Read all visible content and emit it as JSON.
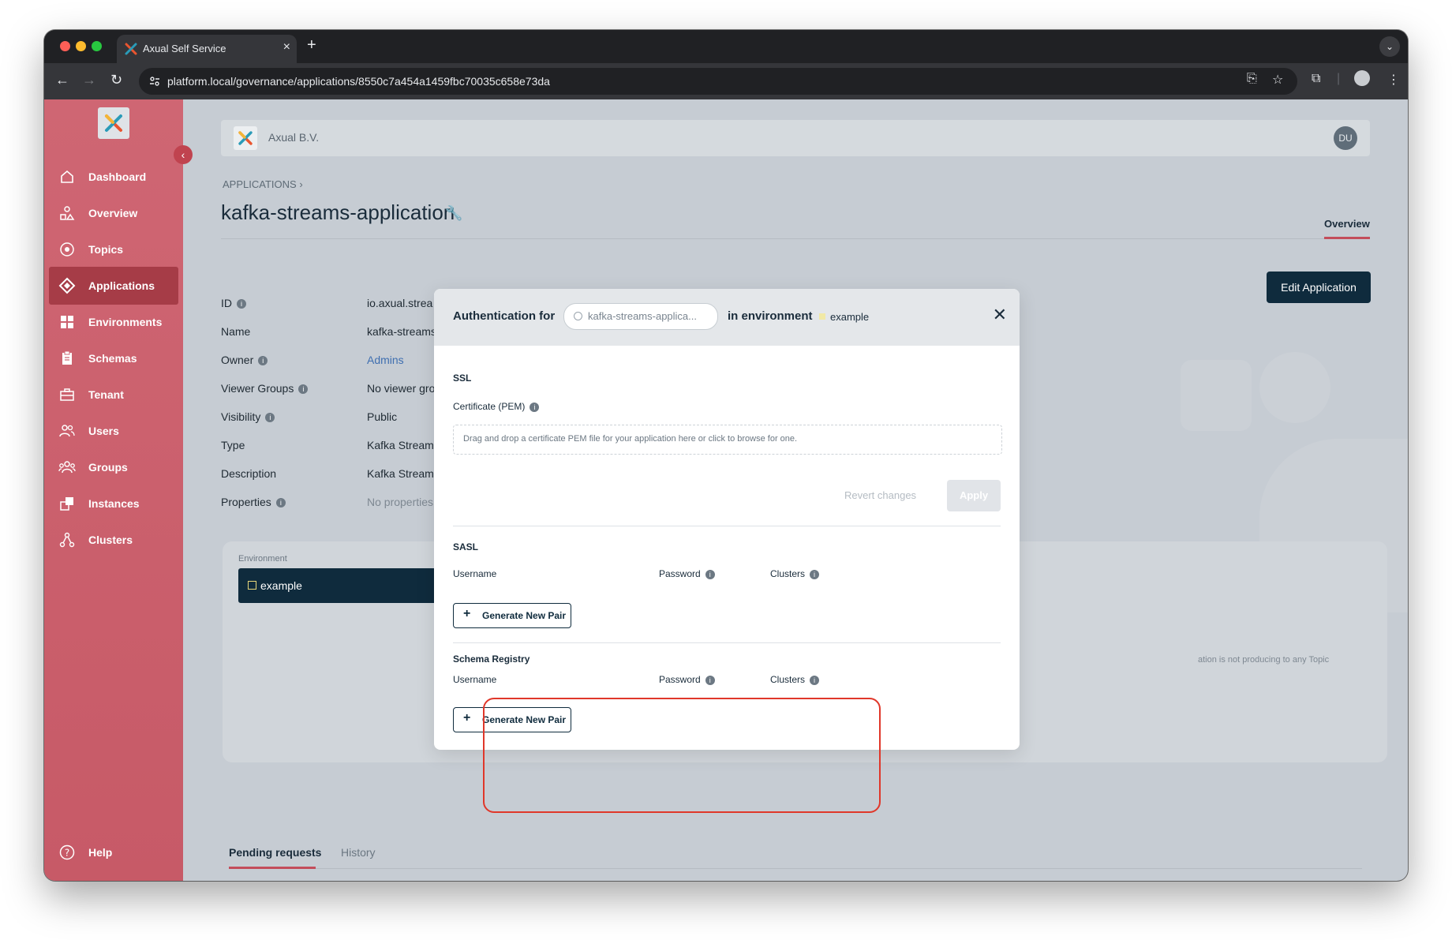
{
  "browser": {
    "tab_title": "Axual Self Service",
    "url": "platform.local/governance/applications/8550c7a454a1459fbc70035c658e73da"
  },
  "sidebar": {
    "items": [
      {
        "label": "Dashboard",
        "icon": "home-icon"
      },
      {
        "label": "Overview",
        "icon": "overview-icon"
      },
      {
        "label": "Topics",
        "icon": "topics-icon"
      },
      {
        "label": "Applications",
        "icon": "applications-icon",
        "active": true
      },
      {
        "label": "Environments",
        "icon": "environments-icon"
      },
      {
        "label": "Schemas",
        "icon": "schemas-icon"
      },
      {
        "label": "Tenant",
        "icon": "tenant-icon"
      },
      {
        "label": "Users",
        "icon": "users-icon"
      },
      {
        "label": "Groups",
        "icon": "groups-icon"
      },
      {
        "label": "Instances",
        "icon": "instances-icon"
      },
      {
        "label": "Clusters",
        "icon": "clusters-icon"
      }
    ],
    "help_label": "Help"
  },
  "topbar": {
    "company": "Axual B.V.",
    "avatar_initials": "DU"
  },
  "page": {
    "breadcrumb": "APPLICATIONS",
    "title": "kafka-streams-application",
    "overview_tab": "Overview",
    "edit_button": "Edit Application"
  },
  "properties": [
    {
      "label": "ID",
      "value": "io.axual.strea",
      "info": true
    },
    {
      "label": "Name",
      "value": "kafka-streams",
      "info": false
    },
    {
      "label": "Owner",
      "value": "Admins",
      "info": true,
      "link": true
    },
    {
      "label": "Viewer Groups",
      "value": "No viewer gro",
      "info": true
    },
    {
      "label": "Visibility",
      "value": "Public",
      "info": true
    },
    {
      "label": "Type",
      "value": "Kafka Stream",
      "info": false
    },
    {
      "label": "Description",
      "value": "Kafka Stream",
      "info": false
    },
    {
      "label": "Properties",
      "value": "No properties",
      "info": true
    }
  ],
  "environment_card": {
    "label": "Environment",
    "selected": "example",
    "notice": "ation is not producing to any Topic"
  },
  "bottom_tabs": {
    "pending": "Pending requests",
    "history": "History"
  },
  "modal": {
    "title_prefix": "Authentication for",
    "app_chip": "kafka-streams-applica...",
    "title_middle": "in environment",
    "environment": "example",
    "ssl": {
      "title": "SSL",
      "cert_label": "Certificate (PEM)",
      "dropzone_text": "Drag and drop a certificate PEM file for your application here or click to browse for one.",
      "revert_label": "Revert changes",
      "apply_label": "Apply"
    },
    "sasl": {
      "title": "SASL",
      "username_label": "Username",
      "password_label": "Password",
      "clusters_label": "Clusters",
      "generate_label": "Generate New Pair"
    },
    "schema_registry": {
      "title": "Schema Registry",
      "username_label": "Username",
      "password_label": "Password",
      "clusters_label": "Clusters",
      "generate_label": "Generate New Pair"
    }
  },
  "colors": {
    "sidebar": "#cf6673",
    "sidebar_active": "#a63c47",
    "primary": "#0f2b3d",
    "accent": "#c34d5b",
    "highlight": "#e0372a"
  }
}
